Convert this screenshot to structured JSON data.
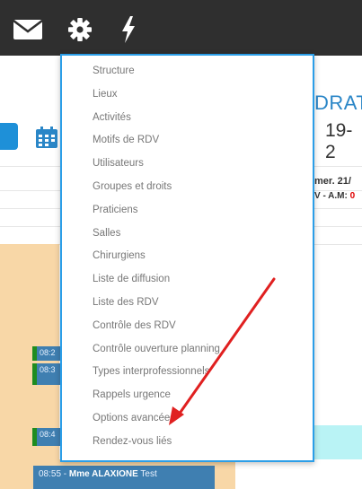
{
  "toolbar": {
    "icons": [
      "envelope-icon",
      "gear-icon",
      "lightning-icon"
    ],
    "background": "#2f2f2f"
  },
  "background": {
    "heading_fragment": "DRAT",
    "range_fragment": "19-2",
    "day_fragment": "mer. 21/",
    "am_prefix": "V - A.M: ",
    "am_value": "0",
    "appointments": [
      {
        "time": "08:2"
      },
      {
        "time": "08:3"
      },
      {
        "time": "08:4"
      }
    ],
    "bottom_appointment": {
      "time": "08:55 - ",
      "name": "Mme ALAXIONE",
      "suffix": " Test"
    }
  },
  "menu": {
    "accent": "#2b9ee8",
    "items": [
      "Structure",
      "Lieux",
      "Activités",
      "Motifs de RDV",
      "Utilisateurs",
      "Groupes et droits",
      "Praticiens",
      "Salles",
      "Chirurgiens",
      "Liste de diffusion",
      "Liste des RDV",
      "Contrôle des RDV",
      "Contrôle ouverture planning",
      "Types interprofessionnels",
      "Rappels urgence",
      "Options avancées",
      "Rendez-vous liés"
    ]
  },
  "annotation": {
    "type": "arrow",
    "color": "#e02020",
    "points_to": "Rendez-vous liés"
  }
}
